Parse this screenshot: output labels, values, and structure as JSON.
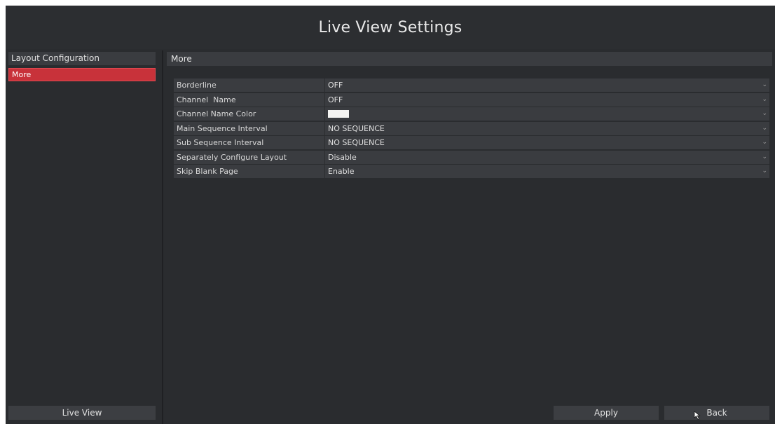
{
  "title": "Live View Settings",
  "sidebar": {
    "header": "Layout Configuration",
    "items": [
      {
        "label": "More",
        "selected": true
      }
    ],
    "live_view_button": "Live View"
  },
  "main": {
    "header": "More",
    "settings": [
      {
        "label": "Borderline",
        "value": "OFF"
      },
      {
        "label": "Channel  Name",
        "value": "OFF"
      },
      {
        "label": "Channel Name Color",
        "value": "",
        "swatch_color": "#f4f4f2"
      },
      {
        "label": "Main Sequence Interval",
        "value": "NO SEQUENCE"
      },
      {
        "label": "Sub Sequence Interval",
        "value": "NO SEQUENCE"
      },
      {
        "label": "Separately Configure Layout",
        "value": "Disable"
      },
      {
        "label": "Skip Blank Page",
        "value": "Enable"
      }
    ]
  },
  "footer": {
    "apply_label": "Apply",
    "back_label": "Back"
  },
  "colors": {
    "background": "#2a2c2f",
    "selected": "#c8323a",
    "row_bg": "#3a3c40"
  },
  "icons": {
    "dropdown": "chevron-down-icon",
    "pointer": "mouse-cursor-icon"
  }
}
